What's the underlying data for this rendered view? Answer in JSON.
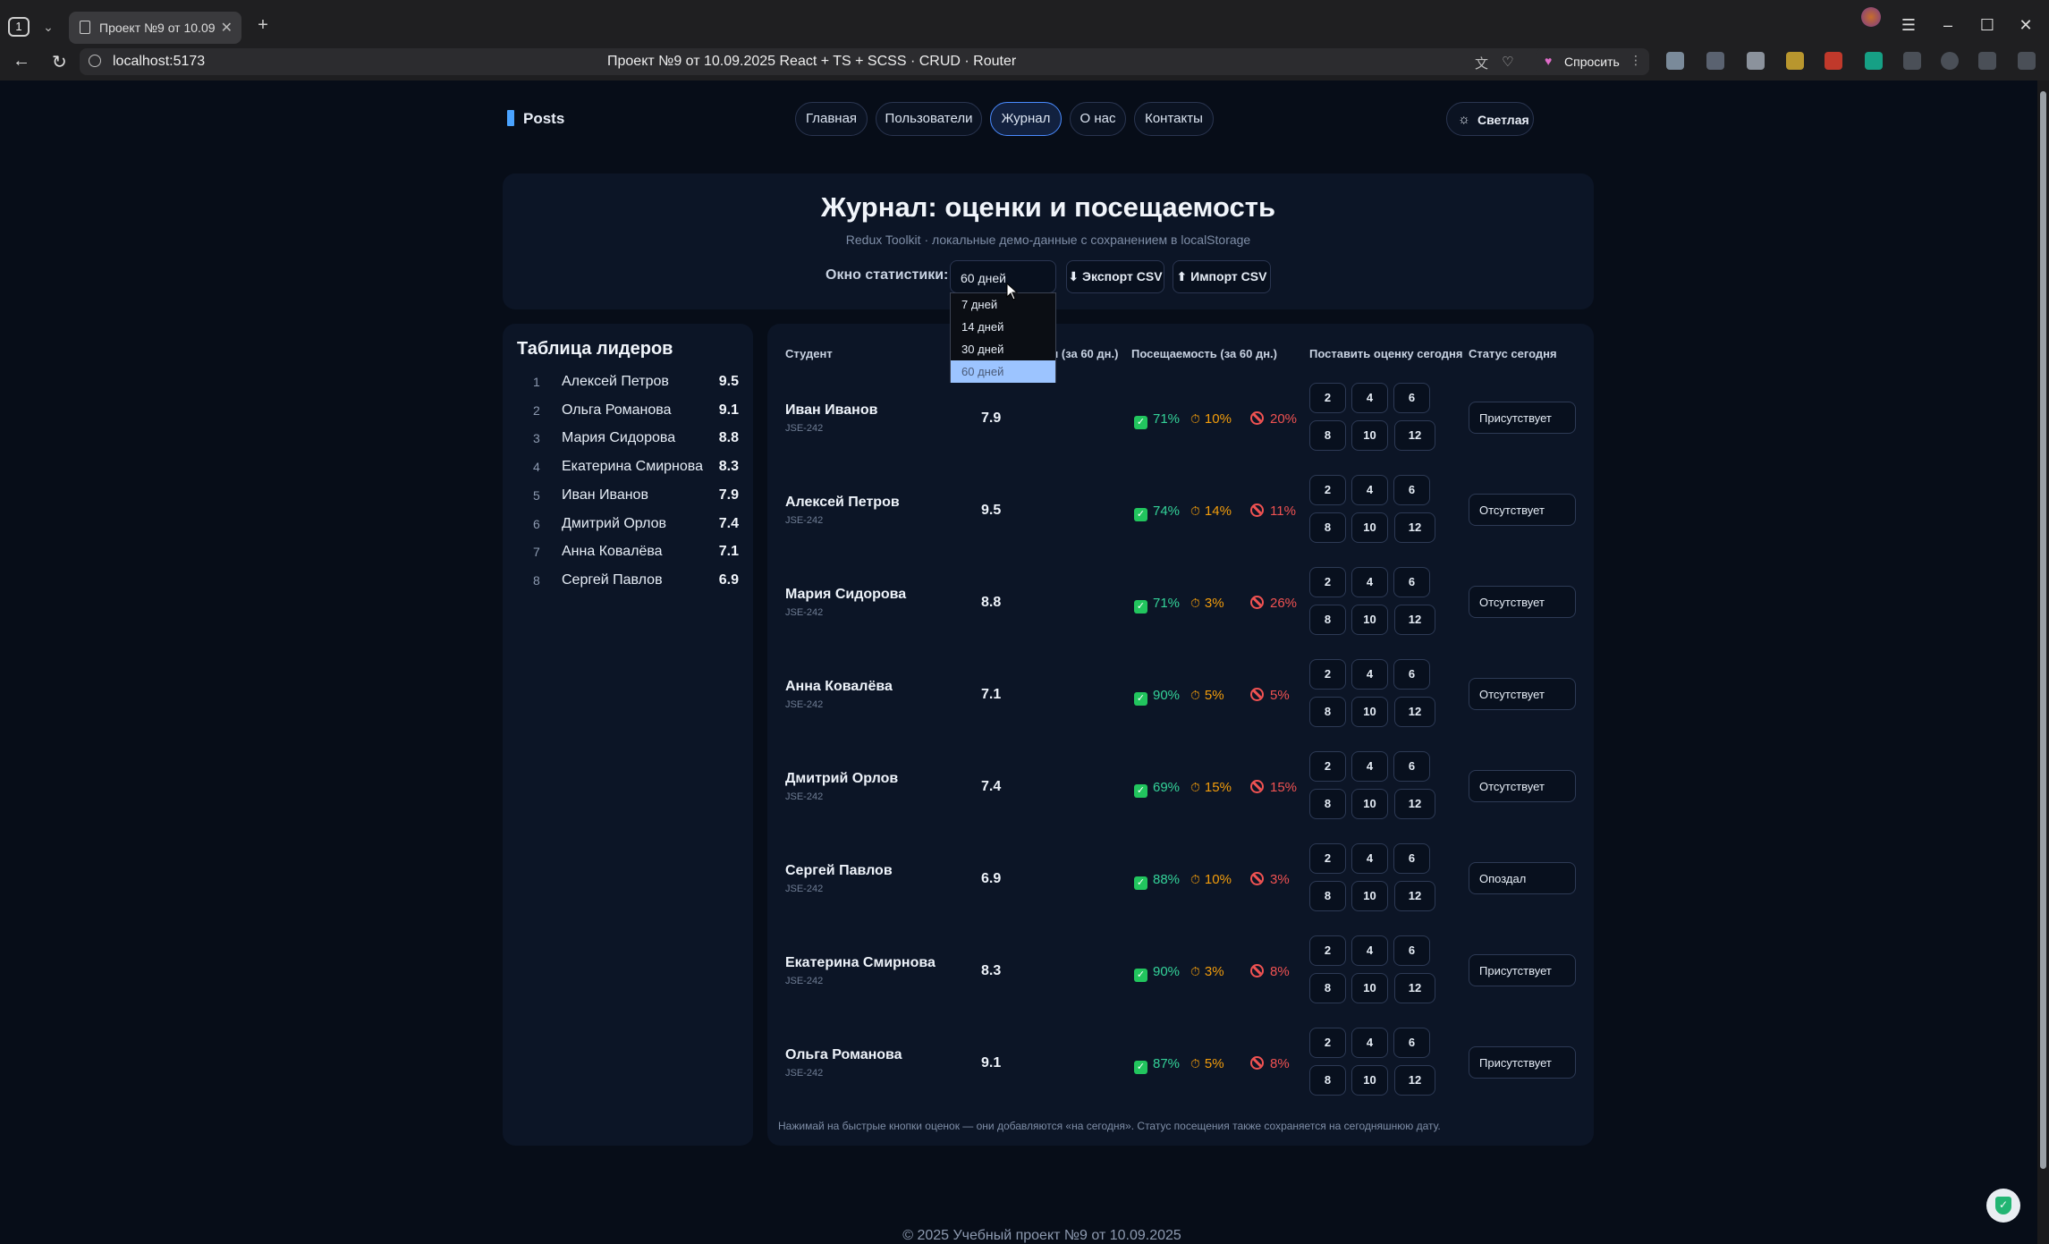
{
  "browser": {
    "tab_counter": "1",
    "tab_title": "Проект №9 от 10.09.2025",
    "url": "localhost:5173",
    "page_title": "Проект №9 от 10.09.2025 React + TS + SCSS · CRUD · Router",
    "ask_label": "Спросить"
  },
  "header": {
    "brand": "Posts",
    "nav": [
      "Главная",
      "Пользователи",
      "Журнал",
      "О нас",
      "Контакты"
    ],
    "active_nav": "Журнал",
    "theme_label": "Светлая"
  },
  "hero": {
    "title": "Журнал: оценки и посещаемость",
    "subtitle": "Redux Toolkit · локальные демо-данные с сохранением в localStorage",
    "window_label": "Окно статистики:",
    "window_value": "60 дней",
    "export_label": "⬇ Экспорт CSV",
    "import_label": "⬆ Импорт CSV",
    "options": [
      "7 дней",
      "14 дней",
      "30 дней",
      "60 дней"
    ]
  },
  "leaderboard": {
    "title": "Таблица лидеров",
    "rows": [
      {
        "rank": "1",
        "name": "Алексей Петров",
        "score": "9.5"
      },
      {
        "rank": "2",
        "name": "Ольга Романова",
        "score": "9.1"
      },
      {
        "rank": "3",
        "name": "Мария Сидорова",
        "score": "8.8"
      },
      {
        "rank": "4",
        "name": "Екатерина Смирнова",
        "score": "8.3"
      },
      {
        "rank": "5",
        "name": "Иван Иванов",
        "score": "7.9"
      },
      {
        "rank": "6",
        "name": "Дмитрий Орлов",
        "score": "7.4"
      },
      {
        "rank": "7",
        "name": "Анна Ковалёва",
        "score": "7.1"
      },
      {
        "rank": "8",
        "name": "Сергей Павлов",
        "score": "6.9"
      }
    ]
  },
  "table": {
    "headers": {
      "student": "Студент",
      "avg": "л (за 60 дн.)",
      "attendance": "Посещаемость (за 60 дн.)",
      "grade": "Поставить оценку сегодня",
      "status": "Статус сегодня"
    },
    "grade_buttons": [
      "2",
      "4",
      "6",
      "8",
      "10",
      "12"
    ],
    "rows": [
      {
        "name": "Иван Иванов",
        "group": "JSE-242",
        "avg": "7.9",
        "present": "71%",
        "late": "10%",
        "absent": "20%",
        "status": "Присутствует"
      },
      {
        "name": "Алексей Петров",
        "group": "JSE-242",
        "avg": "9.5",
        "present": "74%",
        "late": "14%",
        "absent": "11%",
        "status": "Отсутствует"
      },
      {
        "name": "Мария Сидорова",
        "group": "JSE-242",
        "avg": "8.8",
        "present": "71%",
        "late": "3%",
        "absent": "26%",
        "status": "Отсутствует"
      },
      {
        "name": "Анна Ковалёва",
        "group": "JSE-242",
        "avg": "7.1",
        "present": "90%",
        "late": "5%",
        "absent": "5%",
        "status": "Отсутствует"
      },
      {
        "name": "Дмитрий Орлов",
        "group": "JSE-242",
        "avg": "7.4",
        "present": "69%",
        "late": "15%",
        "absent": "15%",
        "status": "Отсутствует"
      },
      {
        "name": "Сергей Павлов",
        "group": "JSE-242",
        "avg": "6.9",
        "present": "88%",
        "late": "10%",
        "absent": "3%",
        "status": "Опоздал"
      },
      {
        "name": "Екатерина Смирнова",
        "group": "JSE-242",
        "avg": "8.3",
        "present": "90%",
        "late": "3%",
        "absent": "8%",
        "status": "Присутствует"
      },
      {
        "name": "Ольга Романова",
        "group": "JSE-242",
        "avg": "9.1",
        "present": "87%",
        "late": "5%",
        "absent": "8%",
        "status": "Присутствует"
      }
    ],
    "footnote": "Нажимай на быстрые кнопки оценок — они добавляются «на сегодня». Статус посещения также сохраняется на сегодняшнюю дату."
  },
  "footer": {
    "text": "© 2025 Учебный проект №9 от 10.09.2025"
  },
  "colors": {
    "page_bg": "#070d18",
    "card_bg": "#0c1526",
    "accent": "#4a8bff",
    "present": "#34d399",
    "late": "#f59e0b",
    "absent": "#f05252"
  }
}
